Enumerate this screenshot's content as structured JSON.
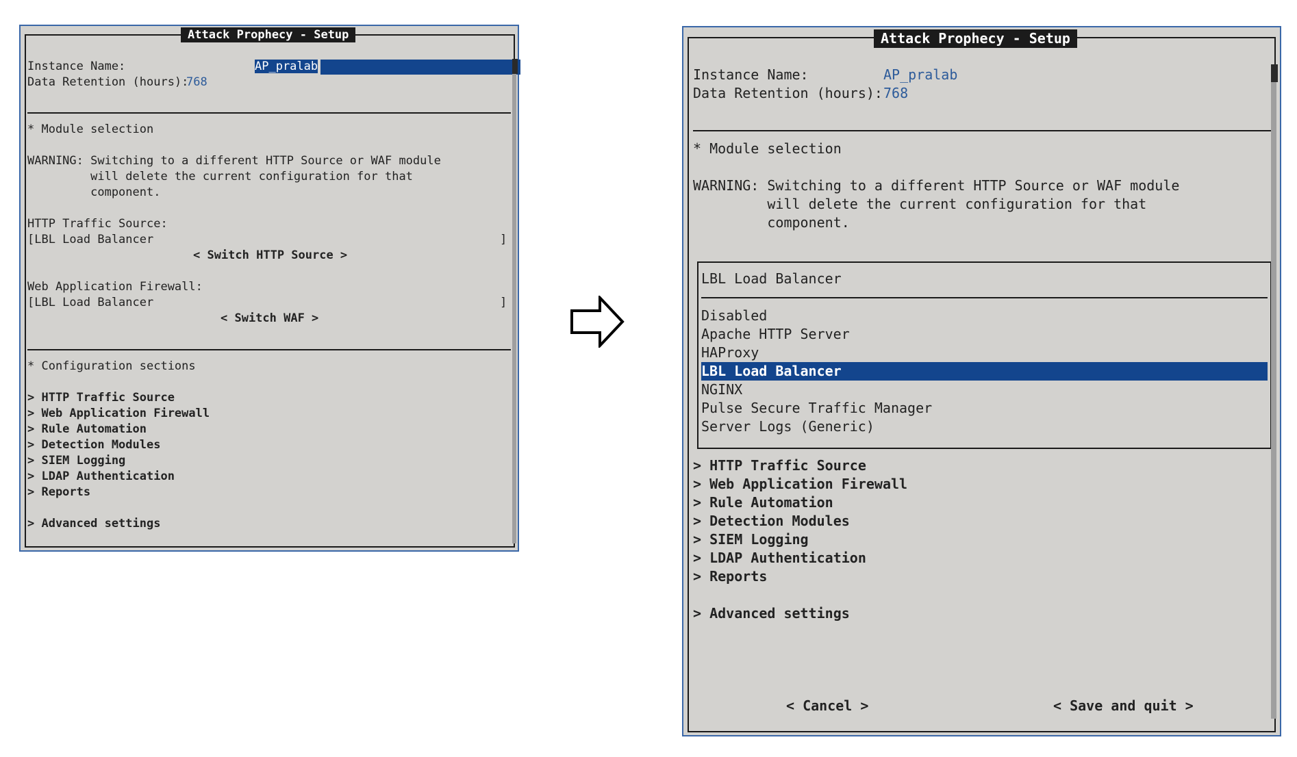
{
  "left": {
    "title": "Attack Prophecy - Setup",
    "instance_name_label": "Instance Name:",
    "instance_name_value": "AP_pralab",
    "data_retention_label": "Data Retention (hours):",
    "data_retention_value": "768",
    "module_selection_heading": "* Module selection",
    "warning_line1": "WARNING: Switching to a different HTTP Source or WAF module",
    "warning_line2": "         will delete the current configuration for that",
    "warning_line3": "         component.",
    "http_source_label": "HTTP Traffic Source:",
    "http_source_value": "[LBL Load Balancer",
    "bracket_close": "]",
    "switch_http_button": "< Switch HTTP Source >",
    "waf_label": "Web Application Firewall:",
    "waf_value": "[LBL Load Balancer",
    "switch_waf_button": "< Switch WAF >",
    "config_heading": "* Configuration sections",
    "sections": [
      "> HTTP Traffic Source",
      "> Web Application Firewall",
      "> Rule Automation",
      "> Detection Modules",
      "> SIEM Logging",
      "> LDAP Authentication",
      "> Reports"
    ],
    "advanced": "> Advanced settings"
  },
  "right": {
    "title": "Attack Prophecy - Setup",
    "instance_name_label": "Instance Name:",
    "instance_name_value": "AP_pralab",
    "data_retention_label": "Data Retention (hours):",
    "data_retention_value": "768",
    "module_selection_heading": "* Module selection",
    "warning_line1": "WARNING: Switching to a different HTTP Source or WAF module",
    "warning_line2": "         will delete the current configuration for that",
    "warning_line3": "         component.",
    "popup_title": "LBL Load Balancer",
    "popup_options": [
      "Disabled",
      "Apache HTTP Server",
      "HAProxy",
      "LBL Load Balancer",
      "NGINX",
      "Pulse Secure Traffic Manager",
      "Server Logs (Generic)"
    ],
    "popup_selected_index": 3,
    "sections": [
      "> HTTP Traffic Source",
      "> Web Application Firewall",
      "> Rule Automation",
      "> Detection Modules",
      "> SIEM Logging",
      "> LDAP Authentication",
      "> Reports"
    ],
    "advanced": "> Advanced settings",
    "cancel_button": "< Cancel >",
    "save_button": "< Save and quit >"
  },
  "colors": {
    "terminal_bg": "#d3d2cf",
    "frame": "#3a67a8",
    "highlight": "#13458d",
    "value_text": "#2d5b9a"
  },
  "icons": {
    "transition": "right-arrow-icon"
  }
}
